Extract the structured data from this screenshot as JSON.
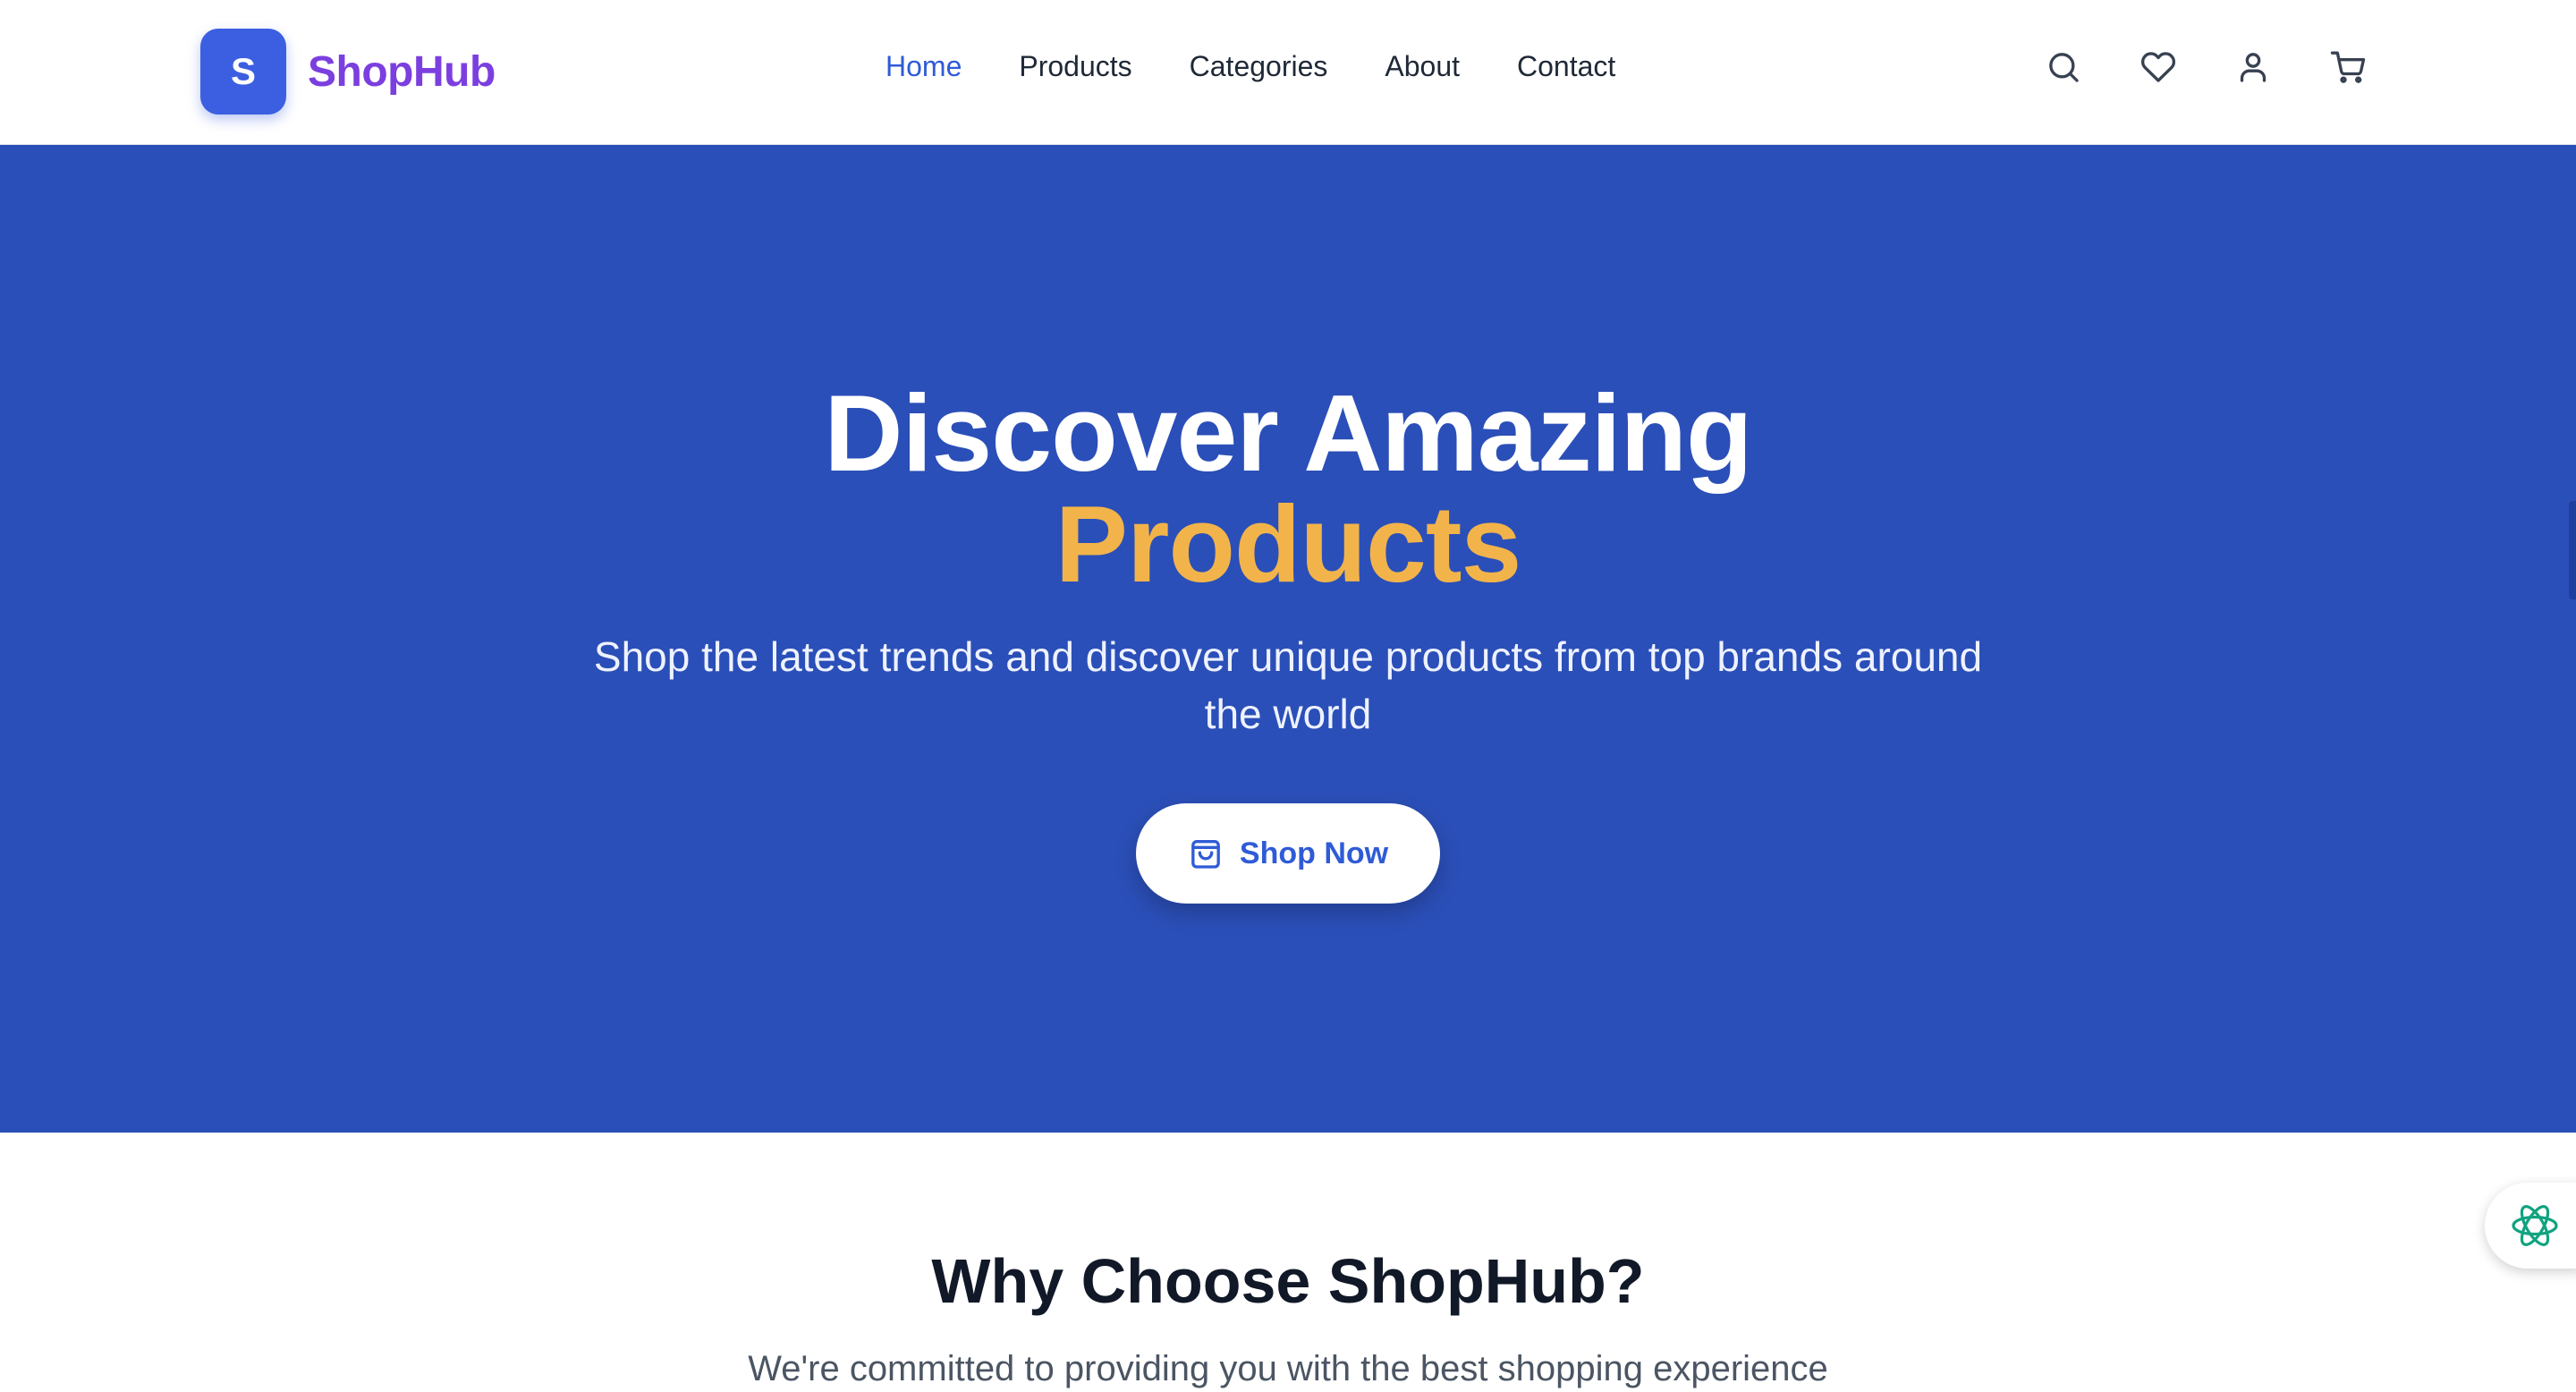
{
  "brand": {
    "badge_letter": "S",
    "name": "ShopHub",
    "badge_color": "#3b5fe0",
    "name_color": "#7b3fe0"
  },
  "nav": {
    "items": [
      {
        "label": "Home",
        "active": true
      },
      {
        "label": "Products",
        "active": false
      },
      {
        "label": "Categories",
        "active": false
      },
      {
        "label": "About",
        "active": false
      },
      {
        "label": "Contact",
        "active": false
      }
    ],
    "active_color": "#2f5bd6"
  },
  "header_icons": [
    "search-icon",
    "heart-icon",
    "user-icon",
    "cart-icon"
  ],
  "hero": {
    "title_line1": "Discover Amazing",
    "title_line2": "Products",
    "subtitle": "Shop the latest trends and discover unique products from top brands around the world",
    "cta_label": "Shop Now",
    "cta_icon": "shopping-bag-icon",
    "background_color": "#2b4fb8",
    "accent_color": "#f2b44a"
  },
  "why": {
    "title": "Why Choose ShopHub?",
    "subtitle": "We're committed to providing you with the best shopping experience"
  },
  "assistant_widget": {
    "icon": "ai-assistant-icon",
    "color": "#10a37f"
  }
}
